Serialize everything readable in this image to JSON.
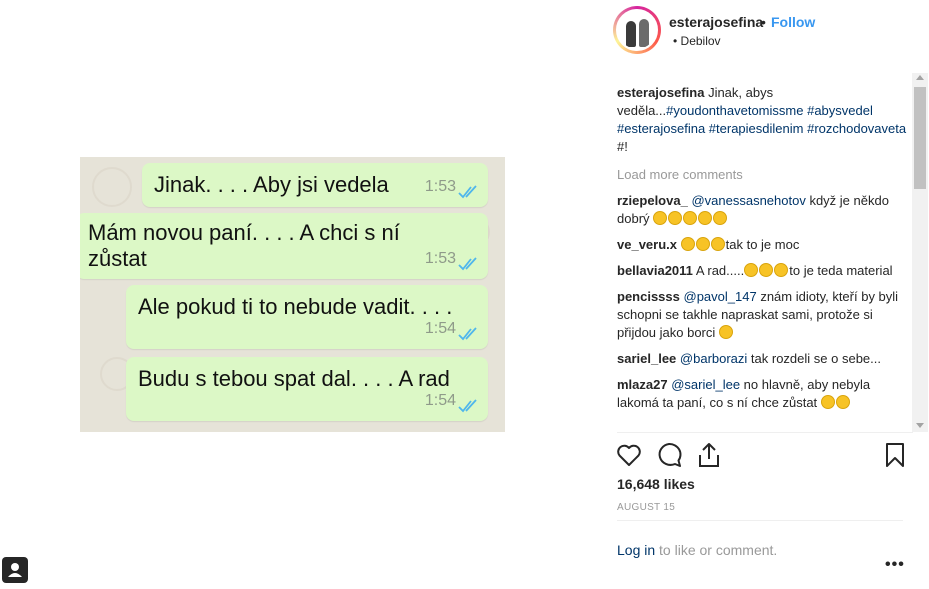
{
  "post": {
    "username": "esterajosefina",
    "separator": "•",
    "follow_label": "Follow",
    "location": "• Debilov"
  },
  "photo": {
    "messages": [
      {
        "text": "Jinak. . . . Aby jsi vedela",
        "time": "1:53"
      },
      {
        "text_line1": "Mám novou paní. . . . A chci s ní",
        "text_line2": "zůstat",
        "time": "1:53"
      },
      {
        "text": "Ale pokud ti to nebude vadit. . . .",
        "time": "1:54"
      },
      {
        "text": "Budu s tebou spat dal. . . . A rad",
        "time": "1:54"
      }
    ]
  },
  "caption": {
    "user": "esterajosefina",
    "text": "Jinak, abys veděla...",
    "tag1": "#youdonthavetomissme",
    "tag2": "#abysvedel",
    "tag3": "#esterajosefina",
    "tag4": "#terapiesdilenim",
    "tag5": "#rozchodovaveta",
    "tail": "#!"
  },
  "load_more": "Load more comments",
  "comments": [
    {
      "user": "rziepelova_",
      "mention": "@vanessasnehotov",
      "text": " když je někdo dobrý "
    },
    {
      "user": "ve_veru.x",
      "text_after": "tak to je moc"
    },
    {
      "user": "bellavia2011",
      "text": "A rad.....",
      "text_after": "to je teda material"
    },
    {
      "user": "pencissss",
      "mention": "@pavol_147",
      "text": " znám idioty, kteří by byli schopni se takhle napraskat sami, protože si přijdou jako borci "
    },
    {
      "user": "sariel_lee",
      "mention": "@barborazi",
      "text": " tak rozdeli se o sebe..."
    },
    {
      "user": "mlaza27",
      "mention": "@sariel_lee",
      "text": " no hlavně, aby nebyla lakomá ta paní, co s ní chce zůstat "
    }
  ],
  "likes": "16,648 likes",
  "date": "AUGUST 15",
  "login": {
    "link": "Log in",
    "rest": " to like or comment."
  },
  "more": "•••",
  "icons": {
    "like": "heart-icon",
    "comment": "comment-icon",
    "share": "share-icon",
    "save": "bookmark-icon"
  },
  "colors": {
    "link": "#3897f0",
    "tag": "#003569",
    "bubble": "#dcf8c6",
    "tick": "#4fb6ec"
  }
}
